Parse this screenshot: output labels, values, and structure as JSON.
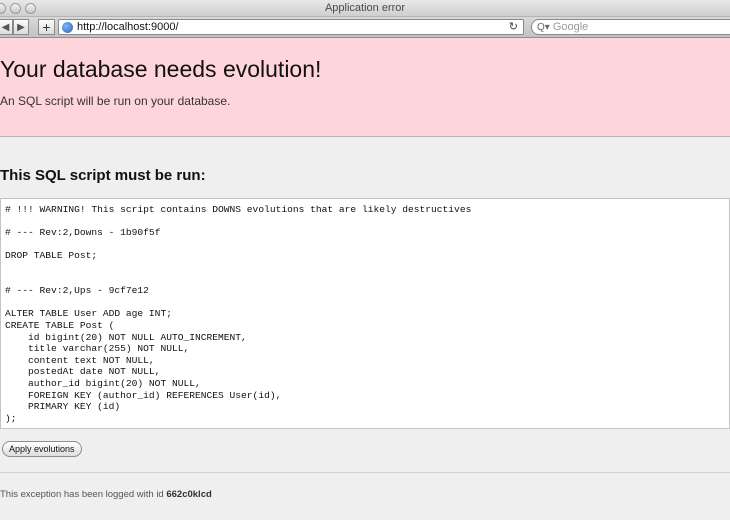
{
  "window": {
    "title": "Application error"
  },
  "toolbar": {
    "back_glyph": "◀",
    "forward_glyph": "▶",
    "add_glyph": "+",
    "url": "http://localhost:9000/",
    "reload_glyph": "↻",
    "search_icon_glyph": "Q▾",
    "search_placeholder": "Google"
  },
  "banner": {
    "title": "Your database needs evolution!",
    "subtitle": "An SQL script will be run on your database.",
    "background": "#ffd5dc"
  },
  "script": {
    "heading": "This SQL script must be run:",
    "sql": "# !!! WARNING! This script contains DOWNS evolutions that are likely destructives\n\n# --- Rev:2,Downs - 1b90f5f\n\nDROP TABLE Post;\n\n\n# --- Rev:2,Ups - 9cf7e12\n\nALTER TABLE User ADD age INT;\nCREATE TABLE Post (\n    id bigint(20) NOT NULL AUTO_INCREMENT,\n    title varchar(255) NOT NULL,\n    content text NOT NULL,\n    postedAt date NOT NULL,\n    author_id bigint(20) NOT NULL,\n    FOREIGN KEY (author_id) REFERENCES User(id),\n    PRIMARY KEY (id)\n);"
  },
  "actions": {
    "apply_label": "Apply evolutions"
  },
  "footer": {
    "text": "This exception has been logged with id ",
    "id": "662c0klcd"
  }
}
